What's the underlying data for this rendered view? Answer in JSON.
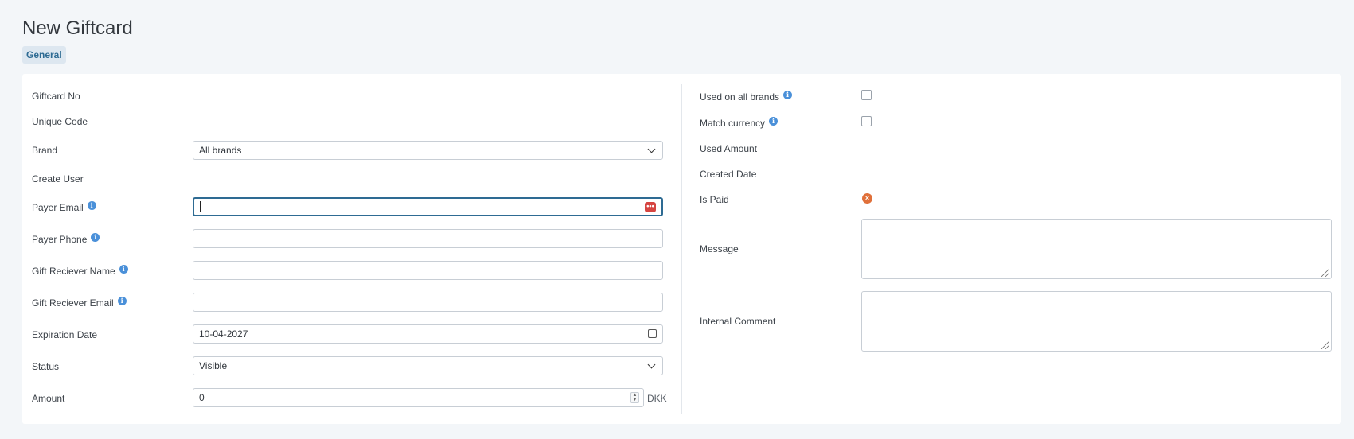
{
  "page": {
    "title": "New Giftcard"
  },
  "tabs": [
    {
      "label": "General"
    }
  ],
  "left": {
    "giftcard_no_label": "Giftcard No",
    "unique_code_label": "Unique Code",
    "brand_label": "Brand",
    "brand_value": "All brands",
    "create_user_label": "Create User",
    "payer_email_label": "Payer Email",
    "payer_email_value": "",
    "payer_phone_label": "Payer Phone",
    "payer_phone_value": "",
    "gift_receiver_name_label": "Gift Reciever Name",
    "gift_receiver_name_value": "",
    "gift_receiver_email_label": "Gift Reciever Email",
    "gift_receiver_email_value": "",
    "expiration_date_label": "Expiration Date",
    "expiration_date_value": "10-04-2027",
    "status_label": "Status",
    "status_value": "Visible",
    "amount_label": "Amount",
    "amount_value": "0",
    "amount_currency": "DKK"
  },
  "right": {
    "used_on_all_brands_label": "Used on all brands",
    "used_on_all_brands_checked": false,
    "match_currency_label": "Match currency",
    "match_currency_checked": false,
    "used_amount_label": "Used Amount",
    "created_date_label": "Created Date",
    "is_paid_label": "Is Paid",
    "is_paid_value": false,
    "message_label": "Message",
    "message_value": "",
    "internal_comment_label": "Internal Comment",
    "internal_comment_value": ""
  },
  "icons": {
    "info": "info-icon",
    "dropdown": "chevron-down-icon",
    "password_manager": "password-manager-icon",
    "calendar": "calendar-icon",
    "spinner": "number-spinner-icon",
    "not_paid": "x-circle-icon"
  },
  "colors": {
    "accent": "#2e6b93",
    "info": "#4a90d9",
    "not_paid": "#e0703a",
    "password_manager": "#d64541"
  }
}
